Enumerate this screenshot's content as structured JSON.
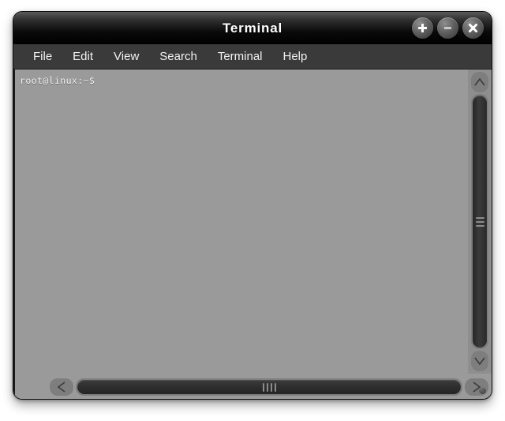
{
  "window": {
    "title": "Terminal",
    "controls": [
      {
        "name": "maximize-button",
        "glyph": "plus",
        "label": "Maximize"
      },
      {
        "name": "minimize-button",
        "glyph": "minus",
        "label": "Minimize"
      },
      {
        "name": "close-button",
        "glyph": "close",
        "label": "Close"
      }
    ]
  },
  "menubar": {
    "items": [
      {
        "label": "File"
      },
      {
        "label": "Edit"
      },
      {
        "label": "View"
      },
      {
        "label": "Search"
      },
      {
        "label": "Terminal"
      },
      {
        "label": "Help"
      }
    ]
  },
  "terminal": {
    "prompt": "root@linux:~$",
    "lines": [
      "root@linux:~$"
    ],
    "background_color": "#9a9a9a",
    "text_color": "#f0f0f0"
  },
  "scrollbars": {
    "vertical": {
      "up_arrow_label": "Scroll up",
      "down_arrow_label": "Scroll down",
      "thumb_label": "Vertical scroll thumb"
    },
    "horizontal": {
      "left_arrow_label": "Scroll left",
      "right_arrow_label": "Scroll right",
      "thumb_label": "Horizontal scroll thumb"
    }
  },
  "colors": {
    "titlebar": "#000000",
    "menubar": "#3a3a3a",
    "terminal_bg": "#9a9a9a",
    "scrollbar_trough": "#7e7e7e",
    "scrollbar_thumb": "#2e2e2e",
    "page_bg": "#ffffff"
  }
}
